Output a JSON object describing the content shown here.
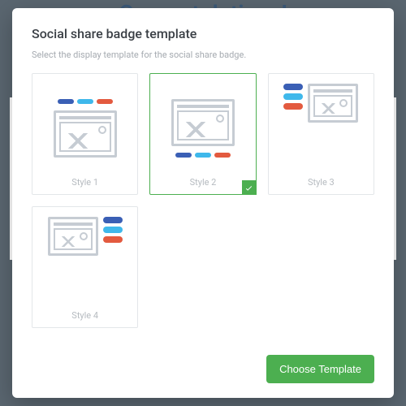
{
  "background": {
    "heading_fragment": "Congratulations!"
  },
  "modal": {
    "title": "Social share badge template",
    "subtitle": "Select the display template for the social share badge.",
    "styles": [
      {
        "label": "Style 1",
        "selected": false
      },
      {
        "label": "Style 2",
        "selected": true
      },
      {
        "label": "Style 3",
        "selected": false
      },
      {
        "label": "Style 4",
        "selected": false
      }
    ],
    "confirm_label": "Choose Template"
  },
  "colors": {
    "accent_green": "#4caf50",
    "pill_blue": "#3a5fb5",
    "pill_cyan": "#3fb8eb",
    "pill_red": "#e35a3f"
  }
}
